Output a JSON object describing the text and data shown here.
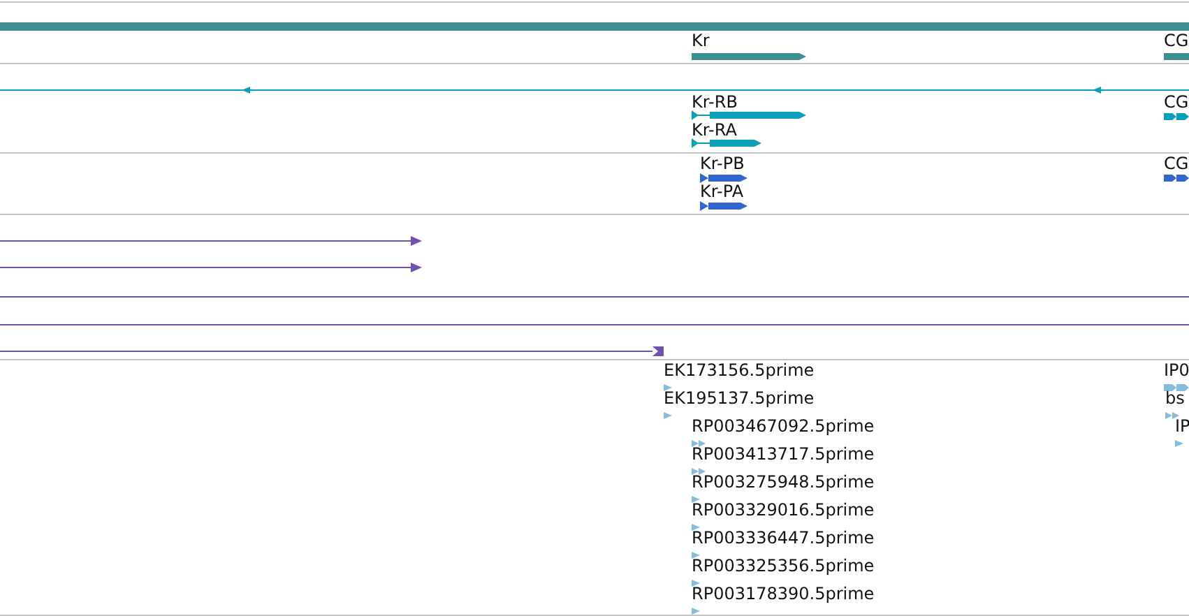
{
  "tracks": [
    {
      "kind": "genes",
      "color": "#3f8f8f",
      "features": [
        {
          "label": "Kr"
        },
        {
          "label": "CG"
        }
      ]
    },
    {
      "kind": "transcripts",
      "color": "#0aa0b8",
      "features": [
        {
          "label": "Kr-RB"
        },
        {
          "label": "Kr-RA"
        },
        {
          "label": "CG"
        }
      ]
    },
    {
      "kind": "proteins",
      "color": "#3366cc",
      "features": [
        {
          "label": "Kr-PB"
        },
        {
          "label": "Kr-PA"
        },
        {
          "label": "CG"
        }
      ]
    },
    {
      "kind": "alignments",
      "color": "#7050aa"
    },
    {
      "kind": "reads",
      "color": "#88bbdd",
      "features": [
        {
          "label": "EK173156.5prime"
        },
        {
          "label": "EK195137.5prime"
        },
        {
          "label": "RP003467092.5prime"
        },
        {
          "label": "RP003413717.5prime"
        },
        {
          "label": "RP003275948.5prime"
        },
        {
          "label": "RP003329016.5prime"
        },
        {
          "label": "RP003336447.5prime"
        },
        {
          "label": "RP003325356.5prime"
        },
        {
          "label": "RP003178390.5prime"
        },
        {
          "label": "IP0"
        },
        {
          "label": "bs"
        },
        {
          "label": "IP"
        }
      ]
    }
  ]
}
